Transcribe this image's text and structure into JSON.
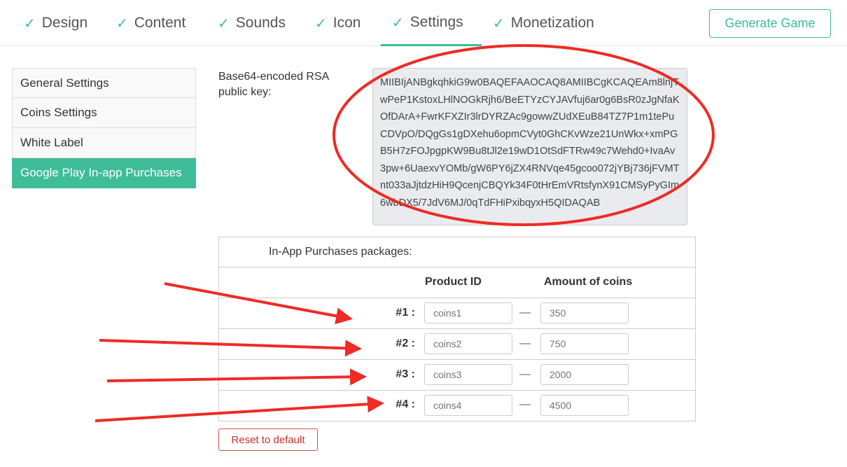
{
  "nav": {
    "tabs": [
      {
        "label": "Design"
      },
      {
        "label": "Content"
      },
      {
        "label": "Sounds"
      },
      {
        "label": "Icon"
      },
      {
        "label": "Settings"
      },
      {
        "label": "Monetization"
      }
    ],
    "active_tab": "Settings",
    "generate_label": "Generate Game"
  },
  "sidebar": {
    "items": [
      {
        "label": "General Settings"
      },
      {
        "label": "Coins Settings"
      },
      {
        "label": "White Label"
      },
      {
        "label": "Google Play In-app Purchases"
      }
    ],
    "active_item": "Google Play In-app Purchases"
  },
  "rsa": {
    "label": "Base64-encoded RSA public key:",
    "value": "MIIBIjANBgkqhkiG9w0BAQEFAAOCAQ8AMIIBCgKCAQEAm8lnjTwPeP1KstoxLHlNOGkRjh6/BeETYzCYJAVfuj6ar0g6BsR0zJgNfaKOfDArA+FwrKFXZIr3lrDYRZAc9gowwZUdXEuB84TZ7P1m1tePuCDVpO/DQgGs1gDXehu6opmCVyt0GhCKvWze21UnWkx+xmPGB5H7zFOJpgpKW9Bu8tJl2e19wD1OtSdFTRw49c7Wehd0+IvaAv3pw+6UaexvYOMb/gW6PY6jZX4RNVqe45gcoo072jYBj736jFVMTnt033aJjtdzHiH9QcenjCBQYk34F0tHrEmVRtsfynX91CMSyPyGIm6wbDX5/7JdV6MJ/0qTdFHiPxibqyxH5QIDAQAB"
  },
  "iap": {
    "title": "In-App Purchases packages:",
    "col_product": "Product ID",
    "col_amount": "Amount of coins",
    "dash": "—",
    "rows": [
      {
        "num": "#1 :",
        "product_placeholder": "coins1",
        "amount_placeholder": "350"
      },
      {
        "num": "#2 :",
        "product_placeholder": "coins2",
        "amount_placeholder": "750"
      },
      {
        "num": "#3 :",
        "product_placeholder": "coins3",
        "amount_placeholder": "2000"
      },
      {
        "num": "#4 :",
        "product_placeholder": "coins4",
        "amount_placeholder": "4500"
      }
    ],
    "reset_label": "Reset to default"
  },
  "colors": {
    "accent": "#3ebd98",
    "annotation": "#ee2b24",
    "danger": "#d9534f"
  }
}
